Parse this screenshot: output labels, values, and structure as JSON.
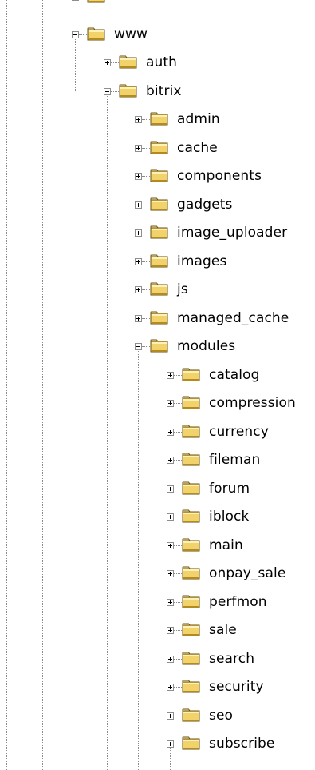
{
  "tree": {
    "nodes": [
      {
        "label": "",
        "state": "collapsed",
        "depth": 0,
        "partial": true
      },
      {
        "label": "www",
        "state": "expanded",
        "depth": 0
      },
      {
        "label": "auth",
        "state": "collapsed",
        "depth": 1
      },
      {
        "label": "bitrix",
        "state": "expanded",
        "depth": 1
      },
      {
        "label": "admin",
        "state": "collapsed",
        "depth": 2
      },
      {
        "label": "cache",
        "state": "collapsed",
        "depth": 2
      },
      {
        "label": "components",
        "state": "collapsed",
        "depth": 2
      },
      {
        "label": "gadgets",
        "state": "collapsed",
        "depth": 2
      },
      {
        "label": "image_uploader",
        "state": "collapsed",
        "depth": 2
      },
      {
        "label": "images",
        "state": "collapsed",
        "depth": 2
      },
      {
        "label": "js",
        "state": "collapsed",
        "depth": 2
      },
      {
        "label": "managed_cache",
        "state": "collapsed",
        "depth": 2
      },
      {
        "label": "modules",
        "state": "expanded",
        "depth": 2
      },
      {
        "label": "catalog",
        "state": "collapsed",
        "depth": 3
      },
      {
        "label": "compression",
        "state": "collapsed",
        "depth": 3
      },
      {
        "label": "currency",
        "state": "collapsed",
        "depth": 3
      },
      {
        "label": "fileman",
        "state": "collapsed",
        "depth": 3
      },
      {
        "label": "forum",
        "state": "collapsed",
        "depth": 3
      },
      {
        "label": "iblock",
        "state": "collapsed",
        "depth": 3
      },
      {
        "label": "main",
        "state": "collapsed",
        "depth": 3
      },
      {
        "label": "onpay_sale",
        "state": "collapsed",
        "depth": 3
      },
      {
        "label": "perfmon",
        "state": "collapsed",
        "depth": 3
      },
      {
        "label": "sale",
        "state": "collapsed",
        "depth": 3
      },
      {
        "label": "search",
        "state": "collapsed",
        "depth": 3
      },
      {
        "label": "security",
        "state": "collapsed",
        "depth": 3
      },
      {
        "label": "seo",
        "state": "collapsed",
        "depth": 3
      },
      {
        "label": "subscribe",
        "state": "collapsed",
        "depth": 3
      }
    ]
  },
  "colors": {
    "folder_fill": "#f2d36b",
    "folder_highlight": "#fff1b8",
    "folder_shadow": "#b28a1f",
    "folder_outline": "#6a5211",
    "connector": "#8a8a8a",
    "expander_border": "#8e8e8e",
    "text": "#000000",
    "background": "#ffffff"
  },
  "icons": {
    "folder": "folder-icon",
    "expand": "expand-plus-icon",
    "collapse": "collapse-minus-icon"
  }
}
